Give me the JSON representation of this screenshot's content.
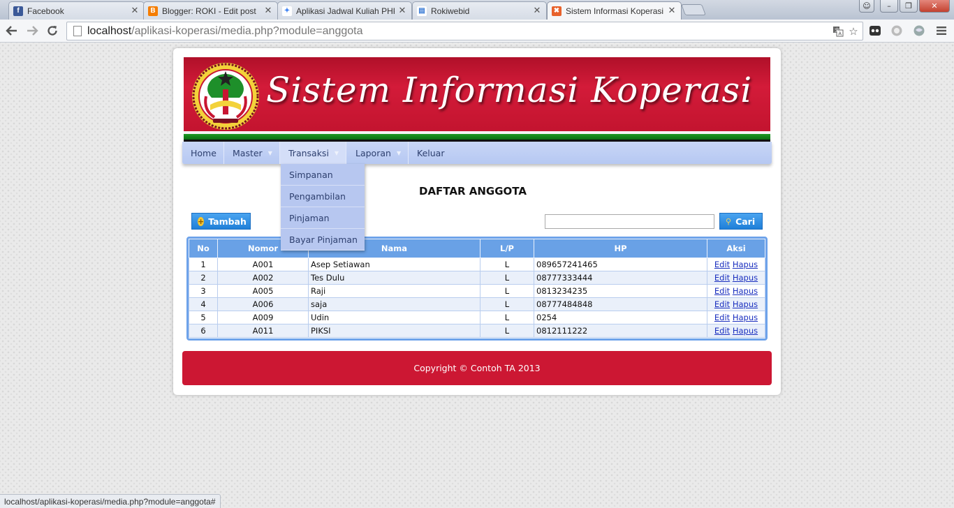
{
  "browser": {
    "tabs": [
      {
        "title": "Facebook",
        "favicon": "f",
        "favicon_color": "#3b5998"
      },
      {
        "title": "Blogger: ROKI - Edit post",
        "favicon": "B",
        "favicon_color": "#f57d00"
      },
      {
        "title": "Aplikasi Jadwal Kuliah PHP",
        "favicon": "✦",
        "favicon_color": "#4285f4"
      },
      {
        "title": "Rokiwebid",
        "favicon": "▤",
        "favicon_color": "#3a7bd5"
      },
      {
        "title": "Sistem Informasi Koperasi",
        "favicon": "✖",
        "favicon_color": "#e8622c"
      }
    ],
    "close_glyph": "✕",
    "url_host": "localhost",
    "url_path": "/aplikasi-koperasi/media.php?module=anggota",
    "status_text": "localhost/aplikasi-koperasi/media.php?module=anggota#",
    "window_buttons": {
      "user": "☺",
      "minimize": "–",
      "maximize": "❐",
      "close": "✕"
    }
  },
  "site": {
    "banner_title": "Sistem Informasi Koperasi",
    "menu": [
      {
        "label": "Home",
        "has_caret": false
      },
      {
        "label": "Master",
        "has_caret": true
      },
      {
        "label": "Transaksi",
        "has_caret": true
      },
      {
        "label": "Laporan",
        "has_caret": true
      },
      {
        "label": "Keluar",
        "has_caret": false
      }
    ],
    "caret_glyph": "▼",
    "dropdown": [
      "Simpanan",
      "Pengambilan",
      "Pinjaman",
      "Bayar Pinjaman"
    ],
    "heading": "DAFTAR ANGGOTA",
    "add_button": "Tambah",
    "search_button": "Cari",
    "search_value": "",
    "table": {
      "headers": [
        "No",
        "Nomor",
        "Nama",
        "L/P",
        "HP",
        "Aksi"
      ],
      "rows": [
        {
          "no": "1",
          "nomor": "A001",
          "nama": "Asep Setiawan",
          "lp": "L",
          "hp": "089657241465"
        },
        {
          "no": "2",
          "nomor": "A002",
          "nama": "Tes Dulu",
          "lp": "L",
          "hp": "08777333444"
        },
        {
          "no": "3",
          "nomor": "A005",
          "nama": "Raji",
          "lp": "L",
          "hp": "0813234235"
        },
        {
          "no": "4",
          "nomor": "A006",
          "nama": "saja",
          "lp": "L",
          "hp": "08777484848"
        },
        {
          "no": "5",
          "nomor": "A009",
          "nama": "Udin",
          "lp": "L",
          "hp": "0254"
        },
        {
          "no": "6",
          "nomor": "A011",
          "nama": "PIKSI",
          "lp": "L",
          "hp": "0812111222"
        }
      ],
      "edit_label": "Edit",
      "delete_label": "Hapus"
    },
    "footer": "Copyright © Contoh TA 2013"
  },
  "colors": {
    "banner_red": "#c81632",
    "menu_blue": "#b6c8f2",
    "table_header_blue": "#69a1e6",
    "button_blue": "#1f7fd8",
    "footer_red": "#cc1733"
  },
  "icons": {
    "back": "arrow-left-icon",
    "forward": "arrow-right-icon",
    "reload": "reload-icon",
    "translate": "translate-icon",
    "bookmark": "star-icon",
    "add": "plus-circle-icon",
    "search": "magnifier-icon"
  }
}
